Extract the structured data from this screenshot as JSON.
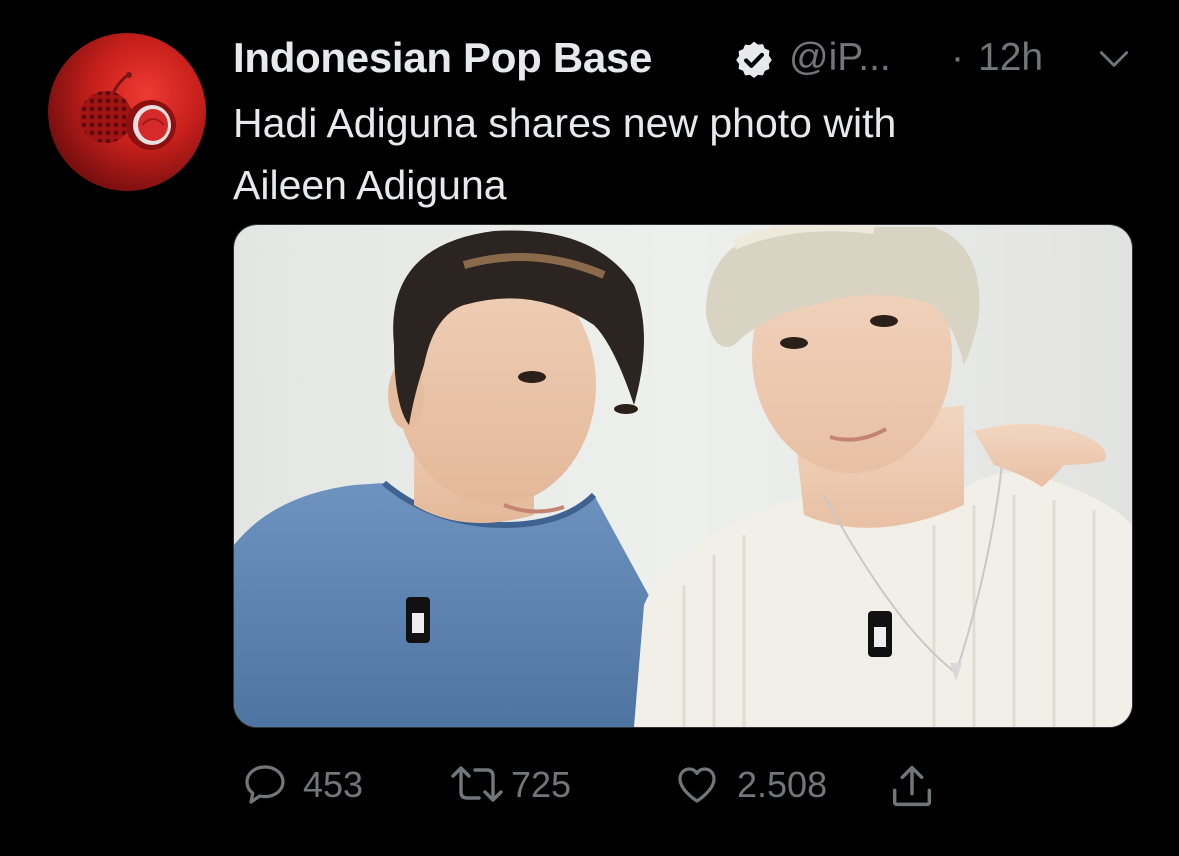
{
  "tweet": {
    "display_name": "Indonesian Pop Base",
    "handle": "@iP...",
    "dot": "·",
    "time": "12h",
    "text": "Hadi Adiguna shares new photo with\nAileen Adiguna",
    "verified_icon": "verified-badge-icon",
    "menu_icon": "chevron-down-icon"
  },
  "actions": {
    "replies": "453",
    "retweets": "725",
    "likes": "2.508",
    "icons": [
      "reply-icon",
      "retweet-icon",
      "like-icon",
      "share-icon"
    ]
  },
  "colors": {
    "background": "#000000",
    "text_primary": "#e7e9ea",
    "text_secondary": "#71767b",
    "avatar_red": "#c8201c"
  }
}
